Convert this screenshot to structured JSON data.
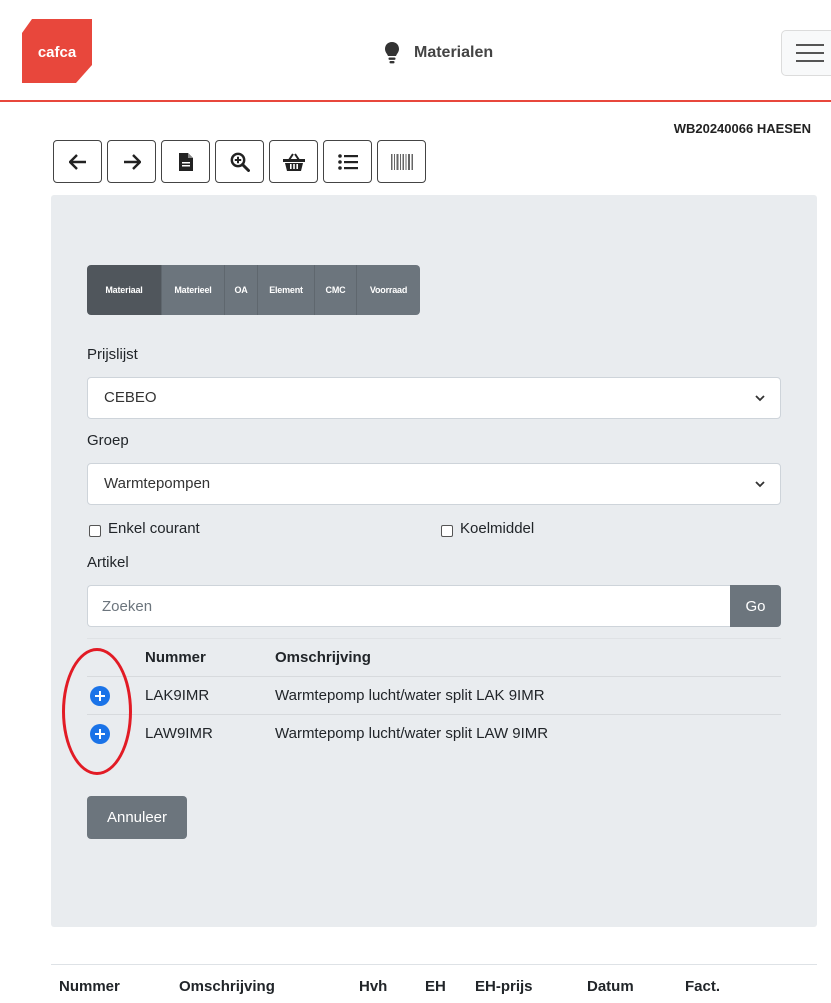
{
  "header": {
    "logo_text": "cafca",
    "title": "Materialen",
    "brand_color": "#e8473c"
  },
  "workorder": "WB20240066 HAESEN",
  "toolbar": {
    "buttons": [
      "arrow-left-icon",
      "arrow-right-icon",
      "document-icon",
      "zoom-in-icon",
      "basket-icon",
      "list-icon",
      "barcode-icon"
    ]
  },
  "tabs": [
    {
      "label": "Materiaal",
      "active": true
    },
    {
      "label": "Materieel",
      "active": false
    },
    {
      "label": "OA",
      "active": false
    },
    {
      "label": "Element",
      "active": false
    },
    {
      "label": "CMC",
      "active": false
    },
    {
      "label": "Voorraad",
      "active": false
    }
  ],
  "form": {
    "prijslijst_label": "Prijslijst",
    "prijslijst_value": "CEBEO",
    "groep_label": "Groep",
    "groep_value": "Warmtepompen",
    "enkel_courant_label": "Enkel courant",
    "koelmiddel_label": "Koelmiddel",
    "artikel_label": "Artikel",
    "search_placeholder": "Zoeken",
    "go_label": "Go"
  },
  "results": {
    "headers": {
      "nummer": "Nummer",
      "omschrijving": "Omschrijving"
    },
    "rows": [
      {
        "nummer": "LAK9IMR",
        "omschrijving": "Warmtepomp lucht/water split LAK 9IMR"
      },
      {
        "nummer": "LAW9IMR",
        "omschrijving": "Warmtepomp lucht/water split LAW 9IMR"
      }
    ]
  },
  "cancel_label": "Annuleer",
  "bottom_table": {
    "headers": [
      "Nummer",
      "Omschrijving",
      "Hvh",
      "EH",
      "EH-prijs",
      "Datum",
      "Fact."
    ]
  }
}
